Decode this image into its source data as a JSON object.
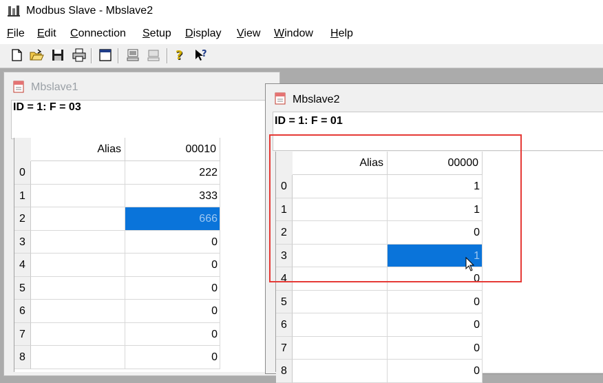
{
  "window": {
    "title": "Modbus Slave - Mbslave2"
  },
  "menu": [
    {
      "pre": "",
      "u": "F",
      "post": "ile"
    },
    {
      "pre": "",
      "u": "E",
      "post": "dit"
    },
    {
      "pre": "",
      "u": "C",
      "post": "onnection"
    },
    {
      "pre": "",
      "u": "S",
      "post": "etup"
    },
    {
      "pre": "",
      "u": "D",
      "post": "isplay"
    },
    {
      "pre": "",
      "u": "V",
      "post": "iew"
    },
    {
      "pre": "",
      "u": "W",
      "post": "indow"
    },
    {
      "pre": "",
      "u": "H",
      "post": "elp"
    }
  ],
  "toolbar": [
    "new-document-icon",
    "open-folder-icon",
    "save-icon",
    "print-icon",
    "window-icon",
    "connect-icon",
    "disconnect-icon",
    "help-icon",
    "context-help-icon"
  ],
  "mbslave1": {
    "title": "Mbslave1",
    "info": "ID = 1: F = 03",
    "alias_header": "Alias",
    "col_header": "00010",
    "rows": [
      {
        "idx": "0",
        "val": "222"
      },
      {
        "idx": "1",
        "val": "333"
      },
      {
        "idx": "2",
        "val": "666"
      },
      {
        "idx": "3",
        "val": "0"
      },
      {
        "idx": "4",
        "val": "0"
      },
      {
        "idx": "5",
        "val": "0"
      },
      {
        "idx": "6",
        "val": "0"
      },
      {
        "idx": "7",
        "val": "0"
      },
      {
        "idx": "8",
        "val": "0"
      }
    ],
    "selected_row": 2
  },
  "mbslave2": {
    "title": "Mbslave2",
    "info": "ID = 1: F = 01",
    "alias_header": "Alias",
    "col_header": "00000",
    "rows": [
      {
        "idx": "0",
        "val": "1"
      },
      {
        "idx": "1",
        "val": "1"
      },
      {
        "idx": "2",
        "val": "0"
      },
      {
        "idx": "3",
        "val": "1"
      },
      {
        "idx": "4",
        "val": "0"
      },
      {
        "idx": "5",
        "val": "0"
      },
      {
        "idx": "6",
        "val": "0"
      },
      {
        "idx": "7",
        "val": "0"
      },
      {
        "idx": "8",
        "val": "0"
      }
    ],
    "selected_row": 3
  },
  "colors": {
    "selection": "#0a74da",
    "highlight_box": "#e53935",
    "mdi_background": "#ababab"
  }
}
